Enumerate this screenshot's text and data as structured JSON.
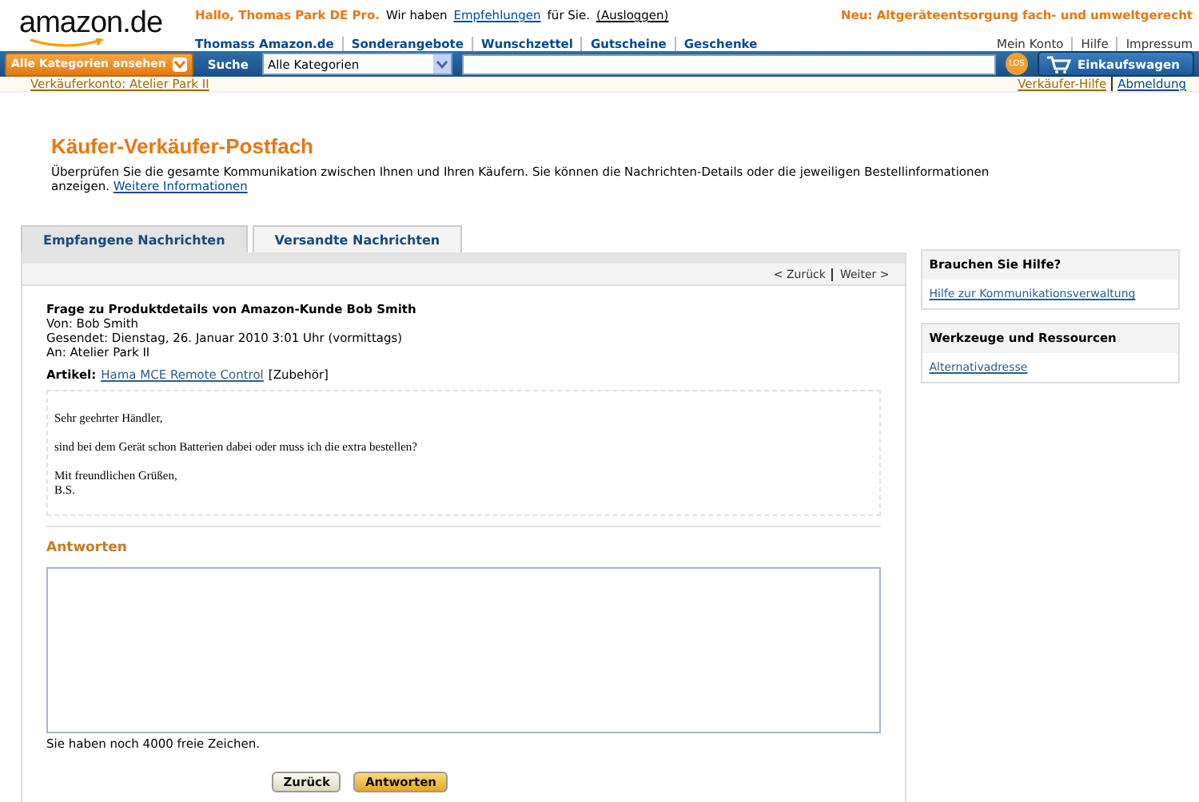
{
  "header": {
    "logo": "amazon.de",
    "greeting": "Hallo, Thomas Park DE Pro.",
    "recommend_pre": "Wir haben",
    "recommend_link": "Empfehlungen",
    "recommend_post": "für Sie.",
    "logout": "(Ausloggen)",
    "promo": "Neu: Altgeräteentsorgung fach- und umweltgerecht",
    "nav": [
      "Thomass Amazon.de",
      "Sonderangebote",
      "Wunschzettel",
      "Gutscheine",
      "Geschenke"
    ],
    "account_links": [
      "Mein Konto",
      "Hilfe",
      "Impressum"
    ]
  },
  "search_bar": {
    "categories_button": "Alle Kategorien ansehen",
    "search_label": "Suche",
    "category_select": "Alle Kategorien",
    "go_button": "LOS",
    "cart_button": "Einkaufswagen"
  },
  "seller_bar": {
    "account": "Verkäuferkonto: Atelier Park II",
    "links": [
      "Verkäufer-Hilfe",
      "Abmeldung"
    ]
  },
  "page": {
    "title": "Käufer-Verkäufer-Postfach",
    "intro": "Überprüfen Sie die gesamte Kommunikation zwischen Ihnen und Ihren Käufern. Sie können die Nachrichten-Details oder die jeweiligen Bestellinformationen anzeigen.",
    "intro_link": "Weitere Informationen"
  },
  "tabs": [
    {
      "label": "Empfangene Nachrichten",
      "selected": true
    },
    {
      "label": "Versandte Nachrichten",
      "selected": false
    }
  ],
  "pager": {
    "prev": "< Zurück",
    "next": "Weiter >"
  },
  "message": {
    "subject": "Frage zu Produktdetails von Amazon-Kunde Bob Smith",
    "meta": [
      "Von: Bob Smith",
      "Gesendet: Dienstag, 26. Januar 2010 3:01 Uhr (vormittags)",
      "An: Atelier Park II"
    ],
    "article_label": "Artikel:",
    "article_link": "Hama MCE Remote Control",
    "article_category": "[Zubehör]",
    "body": [
      [
        "Sehr geehrter Händler,"
      ],
      [
        "sind bei dem Gerät schon Batterien dabei oder muss ich die extra bestellen?"
      ],
      [
        "Mit freundlichen Grüßen,",
        "B.S."
      ]
    ]
  },
  "reply": {
    "heading": "Antworten",
    "remaining": "Sie haben noch 4000 freie Zeichen.",
    "buttons": [
      {
        "label": "Zurück",
        "kind": "secondary"
      },
      {
        "label": "Antworten",
        "kind": "primary"
      }
    ]
  },
  "sidebar": [
    {
      "title": "Brauchen Sie Hilfe?",
      "link": "Hilfe zur Kommunikationsverwaltung"
    },
    {
      "title": "Werkzeuge und Ressourcen",
      "link": "Alternativadresse"
    }
  ]
}
